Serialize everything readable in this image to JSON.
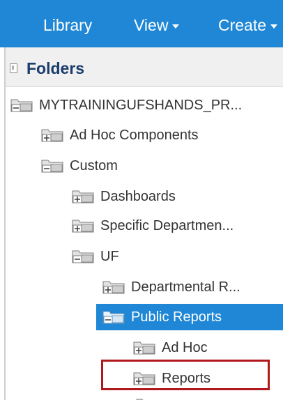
{
  "nav": {
    "library": "Library",
    "view": "View",
    "create": "Create"
  },
  "panel": {
    "title": "Folders"
  },
  "tree": [
    {
      "label": "MYTRAININGUFSHANDS_PR...",
      "toggle": "minus"
    },
    {
      "label": "Ad Hoc Components",
      "toggle": "plus"
    },
    {
      "label": "Custom",
      "toggle": "minus"
    },
    {
      "label": "Dashboards",
      "toggle": "plus"
    },
    {
      "label": "Specific Departmen...",
      "toggle": "plus"
    },
    {
      "label": "UF",
      "toggle": "minus"
    },
    {
      "label": "Departmental R...",
      "toggle": "plus"
    },
    {
      "label": "Public Reports",
      "toggle": "minus",
      "selected": true
    },
    {
      "label": "Ad Hoc",
      "toggle": "plus"
    },
    {
      "label": "Reports",
      "toggle": "plus",
      "highlighted": true
    }
  ],
  "colors": {
    "nav_bg": "#1f87d6",
    "selected_bg": "#1f87d6",
    "highlight_border": "#b0181e",
    "folder_title": "#1a3d6e"
  }
}
